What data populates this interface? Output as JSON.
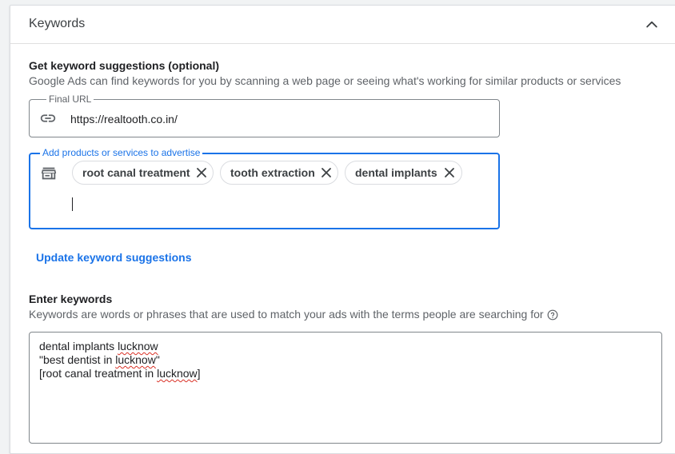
{
  "header": {
    "title": "Keywords",
    "collapse_icon": "chevron-up-icon"
  },
  "suggestions": {
    "title": "Get keyword suggestions (optional)",
    "description": "Google Ads can find keywords for you by scanning a web page or seeing what's working for similar products or services",
    "final_url": {
      "label": "Final URL",
      "value": "https://realtooth.co.in/",
      "icon": "link-icon"
    },
    "products": {
      "label": "Add products or services to advertise",
      "icon": "storefront-icon",
      "chips": [
        {
          "label": "root canal treatment"
        },
        {
          "label": "tooth extraction"
        },
        {
          "label": "dental implants"
        }
      ]
    },
    "update_button": "Update keyword suggestions"
  },
  "keywords": {
    "title": "Enter keywords",
    "description": "Keywords are words or phrases that are used to match your ads with the terms people are searching for",
    "help_icon": "help-circle-icon",
    "lines": [
      {
        "before": "dental implants ",
        "misspelled": "lucknow",
        "after": ""
      },
      {
        "before": "\"best dentist in ",
        "misspelled": "lucknow",
        "after": "\""
      },
      {
        "before": "[root canal treatment in ",
        "misspelled": "lucknow",
        "after": "]"
      }
    ]
  },
  "colors": {
    "accent": "#1a73e8",
    "text": "#202124",
    "secondary_text": "#5f6368",
    "border": "#80868b",
    "spellcheck": "#d93025"
  }
}
